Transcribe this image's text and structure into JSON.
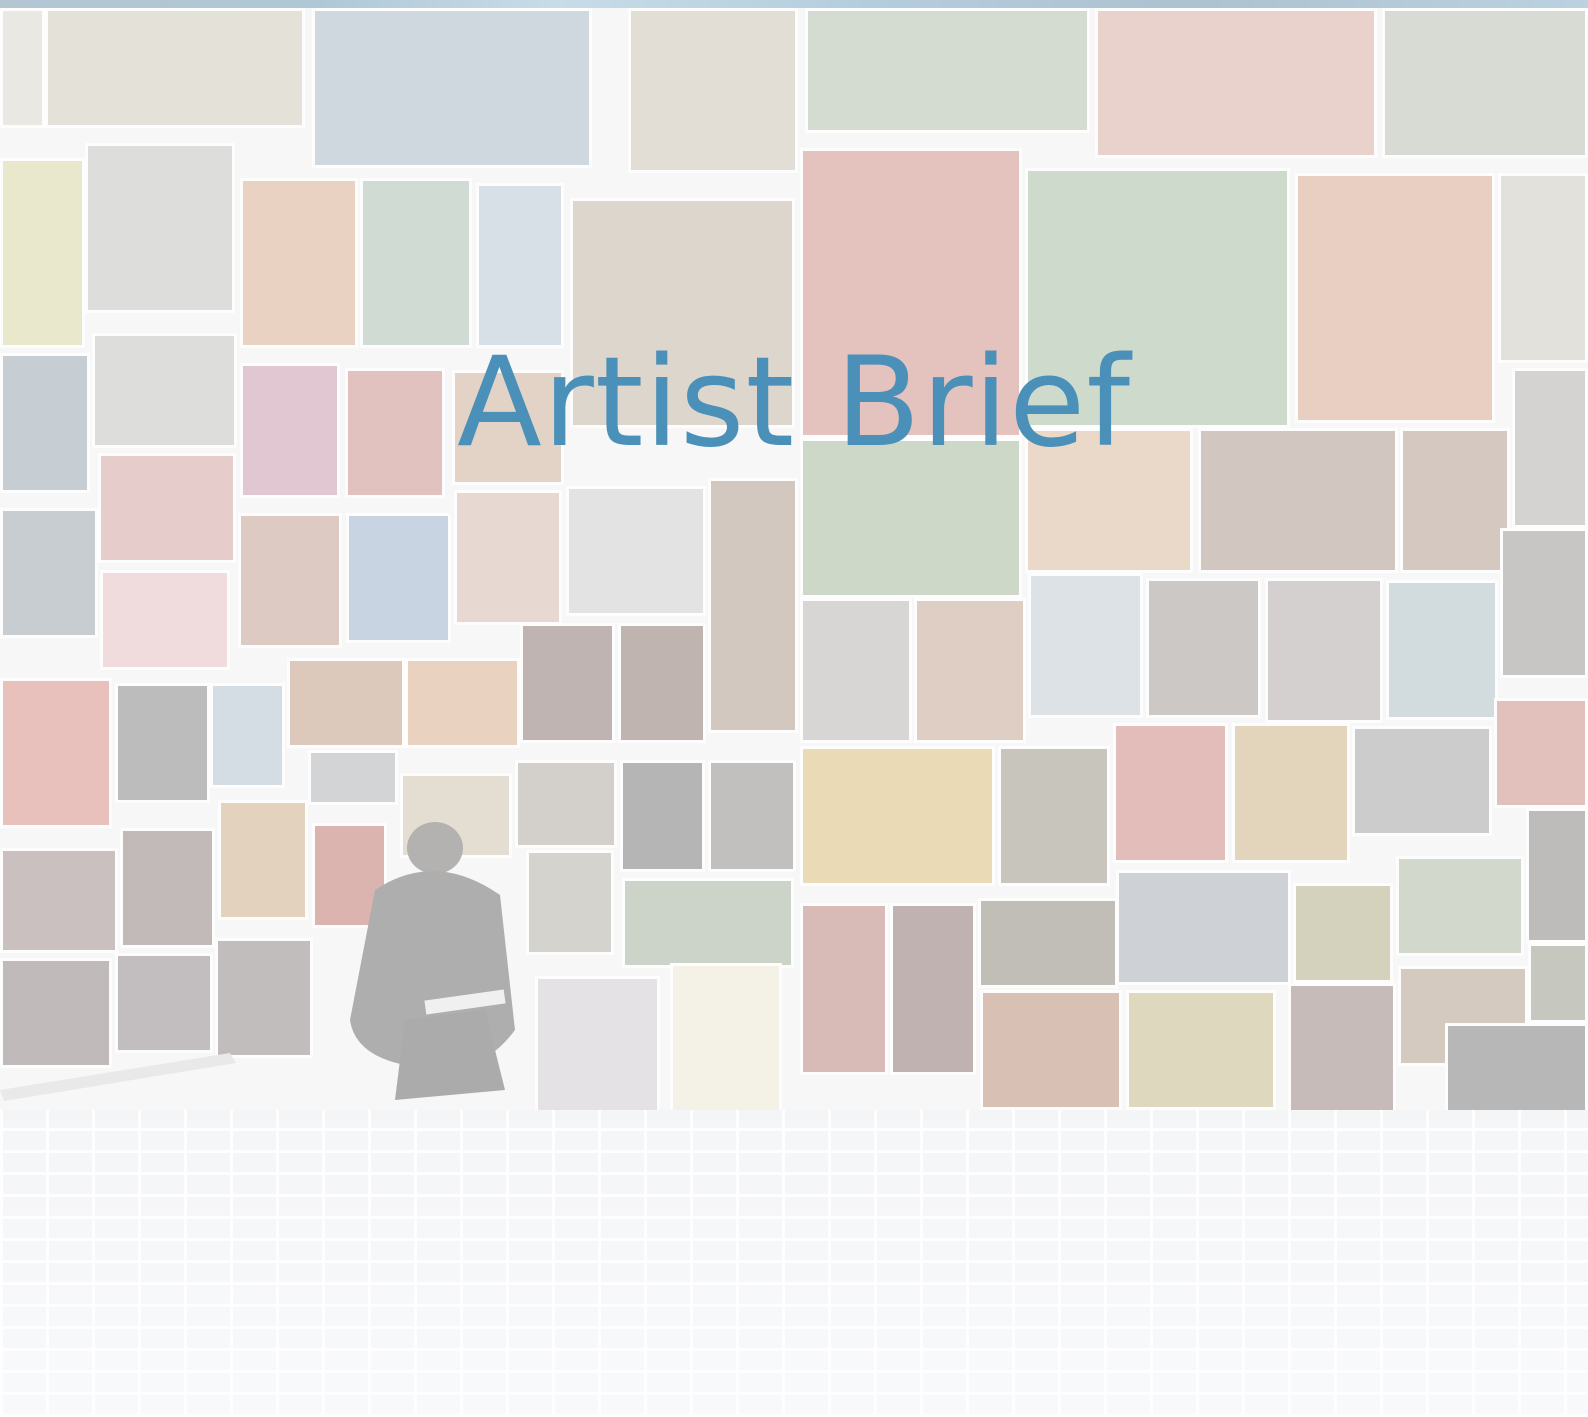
{
  "slide": {
    "title": "Artist Brief"
  },
  "colors": {
    "title": "#4a90b8",
    "accent_bar": "#2f6d93"
  }
}
